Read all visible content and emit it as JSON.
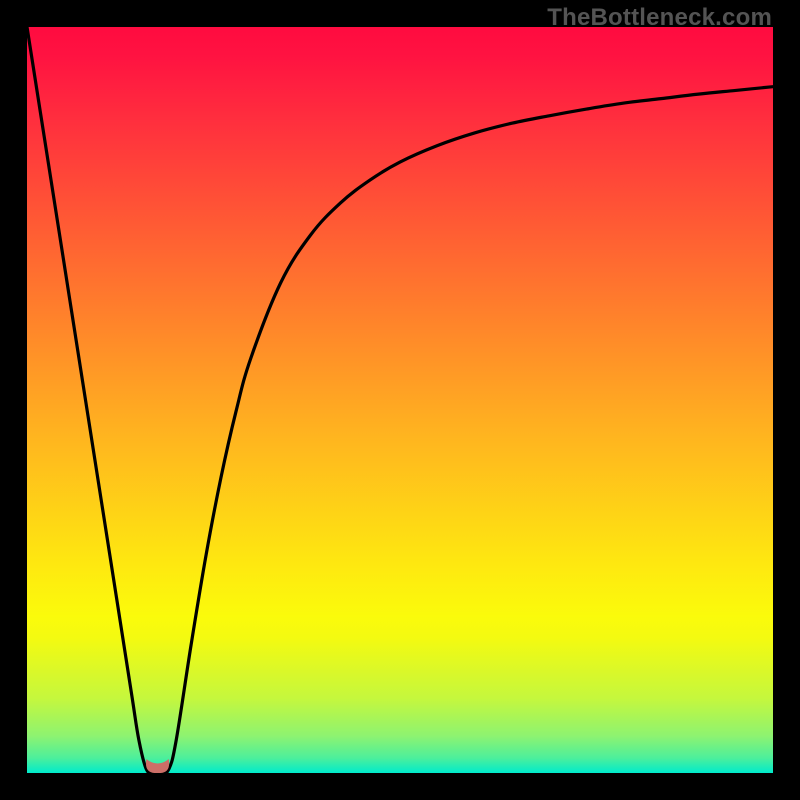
{
  "attribution": "TheBottleneck.com",
  "colors": {
    "frame": "#000000",
    "gradient_top": "#ff0b40",
    "gradient_bottom": "#00ebcc",
    "curve_stroke": "#000000",
    "blob_fill": "#cc6e67",
    "attribution_text": "#545454"
  },
  "chart_data": {
    "type": "line",
    "title": "",
    "xlabel": "",
    "ylabel": "",
    "xlim": [
      0,
      100
    ],
    "ylim": [
      0,
      100
    ],
    "x": [
      0,
      4,
      8,
      12,
      14,
      15,
      16,
      17,
      18,
      19,
      20,
      22,
      24,
      26,
      28,
      30,
      34,
      38,
      42,
      46,
      50,
      55,
      60,
      65,
      70,
      75,
      80,
      85,
      90,
      95,
      100
    ],
    "y": [
      100,
      74.5,
      49,
      23.5,
      10.7,
      4.4,
      0.5,
      0,
      0,
      0.5,
      4.4,
      17.2,
      29.2,
      39.6,
      48.4,
      55.6,
      65.7,
      72.1,
      76.4,
      79.5,
      81.9,
      84.1,
      85.8,
      87.1,
      88.1,
      89,
      89.8,
      90.4,
      91,
      91.5,
      92
    ],
    "minimum_marker": {
      "x_range": [
        16,
        19
      ],
      "y": 0,
      "shape": "rounded-blob"
    },
    "notes": "x and y are percentages of the plot area (0 = left/bottom, 100 = right/top). Curve drops sharply from top-left, hits 0 near x≈17, then rises asymptotically toward ~92 at right edge."
  }
}
